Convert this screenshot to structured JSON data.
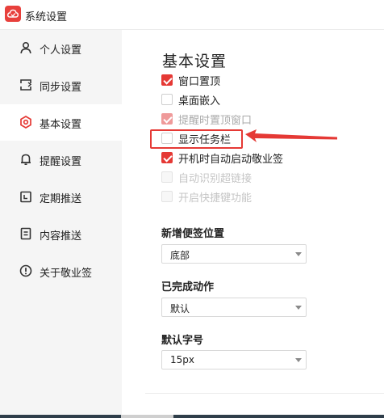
{
  "window": {
    "title": "系统设置"
  },
  "colors": {
    "accent": "#e53935",
    "sidebar_bg": "#f5f5f5",
    "annotation": "#e53935"
  },
  "sidebar": {
    "items": [
      {
        "label": "个人设置",
        "icon": "user-icon",
        "active": false
      },
      {
        "label": "同步设置",
        "icon": "sync-icon",
        "active": false
      },
      {
        "label": "基本设置",
        "icon": "settings-gear-icon",
        "active": true
      },
      {
        "label": "提醒设置",
        "icon": "bell-icon",
        "active": false
      },
      {
        "label": "定期推送",
        "icon": "calendar-icon",
        "active": false
      },
      {
        "label": "内容推送",
        "icon": "document-icon",
        "active": false
      },
      {
        "label": "关于敬业签",
        "icon": "info-icon",
        "active": false
      }
    ]
  },
  "main": {
    "title": "基本设置",
    "options": [
      {
        "label": "窗口置顶",
        "checked": true,
        "enabled": true
      },
      {
        "label": "桌面嵌入",
        "checked": false,
        "enabled": true
      },
      {
        "label": "提醒时置顶窗口",
        "checked": true,
        "enabled": false
      },
      {
        "label": "显示任务栏",
        "checked": false,
        "enabled": true,
        "highlighted": true
      },
      {
        "label": "开机时自动启动敬业签",
        "checked": true,
        "enabled": true
      },
      {
        "label": "自动识别超链接",
        "checked": false,
        "enabled": false
      },
      {
        "label": "开启快捷键功能",
        "checked": false,
        "enabled": false
      }
    ],
    "new_note_position": {
      "label": "新增便签位置",
      "value": "底部"
    },
    "completed_action": {
      "label": "已完成动作",
      "value": "默认"
    },
    "default_font_size": {
      "label": "默认字号",
      "value": "15px"
    }
  }
}
